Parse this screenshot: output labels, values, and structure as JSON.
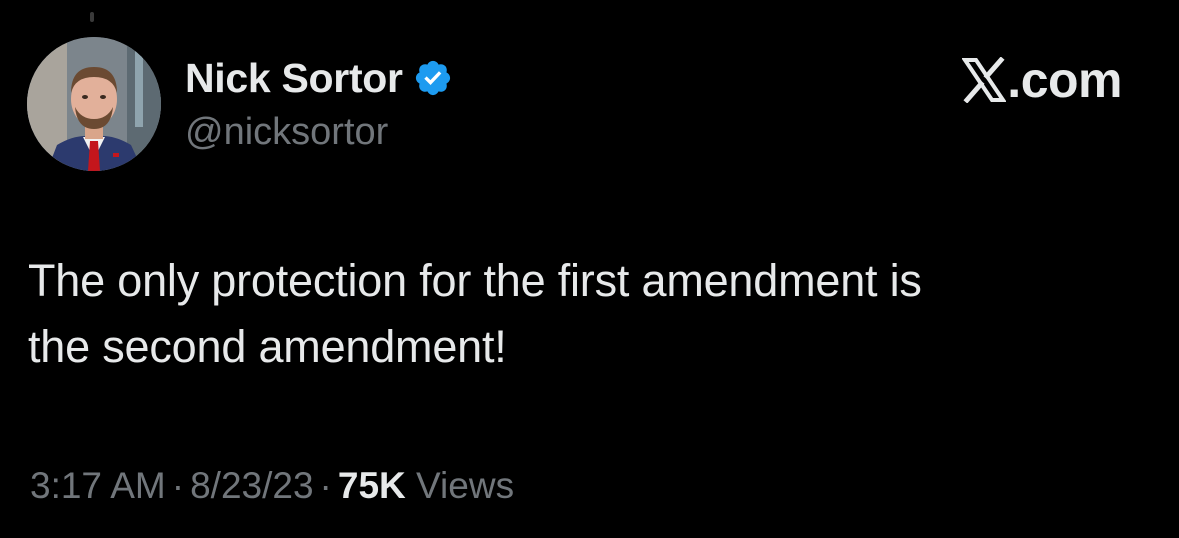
{
  "tweet": {
    "author": {
      "display_name": "Nick Sortor",
      "handle": "@nicksortor",
      "verified": true,
      "verified_icon": "verified-badge-icon",
      "verified_color": "#1d9bf0"
    },
    "brand": {
      "label": ".com",
      "icon": "x-logo-icon"
    },
    "text_line1": "The only protection for the first amendment is",
    "text_line2": "the second amendment!",
    "meta": {
      "time": "3:17 AM",
      "separator": "·",
      "date": "8/23/23",
      "views_count": "75K",
      "views_label": "Views"
    }
  },
  "colors": {
    "background": "#000000",
    "primary_text": "#e7e9ea",
    "secondary_text": "#71767b",
    "accent": "#1d9bf0"
  }
}
